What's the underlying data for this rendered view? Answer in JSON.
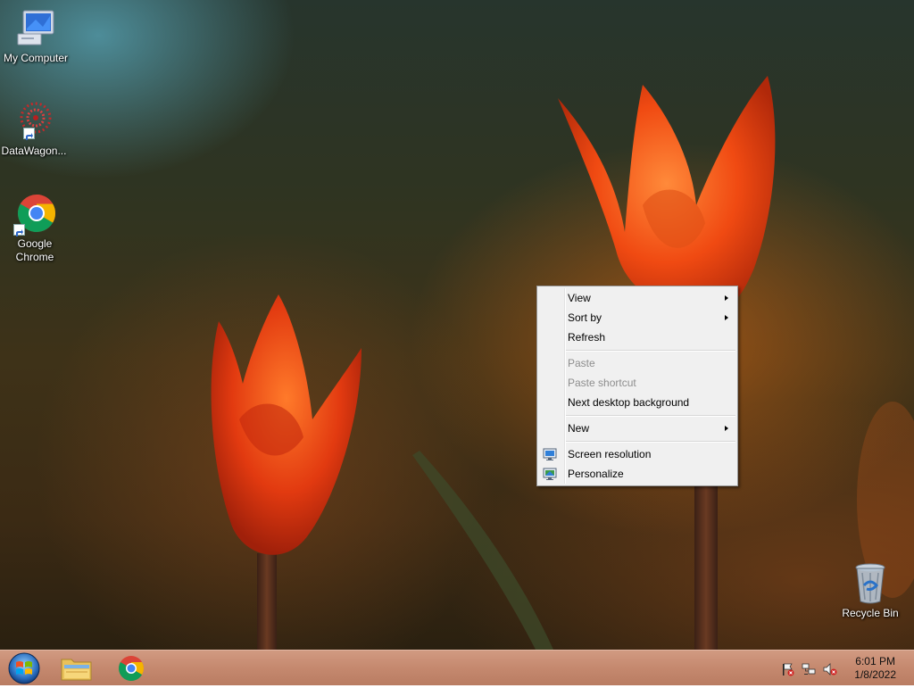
{
  "desktop": {
    "icons": [
      {
        "label": "My Computer",
        "icon": "computer-icon"
      },
      {
        "label": "DataWagon...",
        "icon": "datawagon-icon"
      },
      {
        "label": "Google Chrome",
        "icon": "chrome-icon"
      },
      {
        "label": "Recycle Bin",
        "icon": "recycle-bin-icon"
      }
    ]
  },
  "context_menu": {
    "items": [
      {
        "label": "View",
        "submenu": true,
        "enabled": true
      },
      {
        "label": "Sort by",
        "submenu": true,
        "enabled": true
      },
      {
        "label": "Refresh",
        "enabled": true
      },
      {
        "label": "Paste",
        "enabled": false
      },
      {
        "label": "Paste shortcut",
        "enabled": false
      },
      {
        "label": "Next desktop background",
        "enabled": true
      },
      {
        "label": "New",
        "submenu": true,
        "enabled": true
      },
      {
        "label": "Screen resolution",
        "enabled": true,
        "icon": "display-icon"
      },
      {
        "label": "Personalize",
        "enabled": true,
        "icon": "personalize-icon"
      }
    ]
  },
  "taskbar": {
    "start_icon": "windows-start-icon",
    "pinned": [
      "file-explorer-icon",
      "chrome-icon"
    ],
    "tray": {
      "icons": [
        "action-center-flag-icon",
        "network-icon",
        "volume-muted-icon"
      ],
      "time": "6:01 PM",
      "date": "1/8/2022"
    }
  },
  "colors": {
    "menu_bg": "#f0f0f0",
    "taskbar": "#c68a70",
    "disabled_text": "#8d8d8d"
  }
}
